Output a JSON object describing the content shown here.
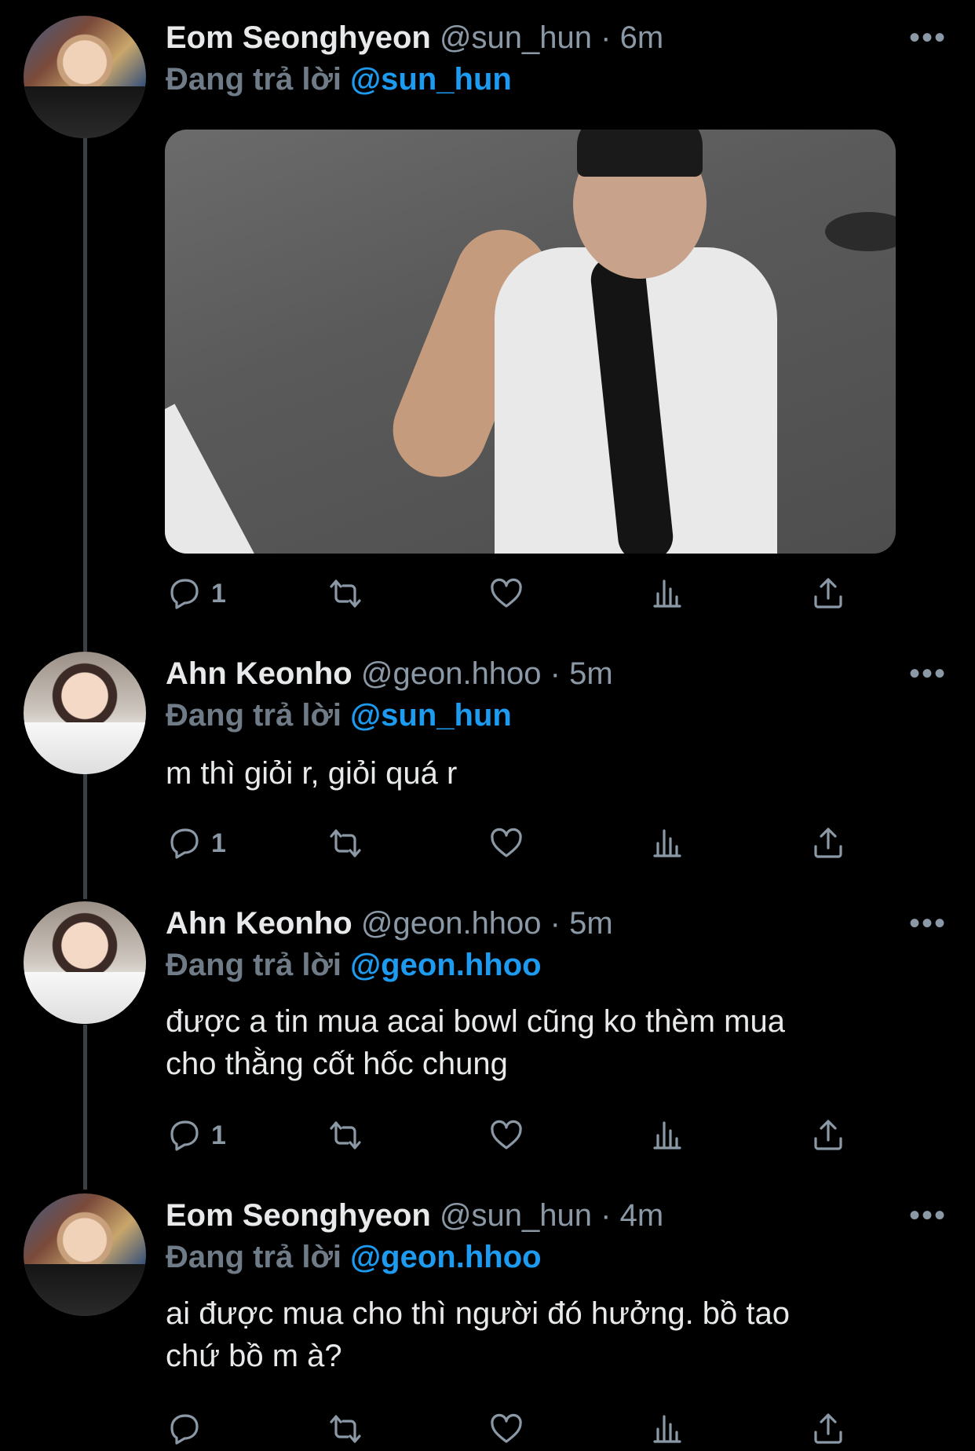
{
  "tweets": [
    {
      "name": "Eom Seonghyeon",
      "handle": "@sun_hun",
      "time": "6m",
      "reply_prefix": "Đang trả lời",
      "reply_to": "@sun_hun",
      "text": "",
      "has_media": true,
      "reply_count": "1",
      "avatar": "eom-avatar"
    },
    {
      "name": "Ahn Keonho",
      "handle": "@geon.hhoo",
      "time": "5m",
      "reply_prefix": "Đang trả lời",
      "reply_to": "@sun_hun",
      "text": "m thì giỏi r, giỏi quá r",
      "reply_count": "1",
      "avatar": "ahn-avatar"
    },
    {
      "name": "Ahn Keonho",
      "handle": "@geon.hhoo",
      "time": "5m",
      "reply_prefix": "Đang trả lời",
      "reply_to": "@geon.hhoo",
      "text_lines": [
        "được a tin mua acai bowl cũng ko thèm mua",
        "cho thằng cốt hốc chung"
      ],
      "reply_count": "1",
      "avatar": "ahn-avatar"
    },
    {
      "name": "Eom Seonghyeon",
      "handle": "@sun_hun",
      "time": "4m",
      "reply_prefix": "Đang trả lời",
      "reply_to": "@geon.hhoo",
      "text_lines": [
        "ai được mua cho thì người đó hưởng. bồ tao",
        "chứ bồ m à?"
      ],
      "avatar": "eom-avatar"
    }
  ],
  "separator": "·",
  "more_label": "•••",
  "colors": {
    "background": "#000000",
    "mention": "#1d9bf0",
    "secondary": "#8b98a5",
    "thread_line": "#3a3f44"
  }
}
